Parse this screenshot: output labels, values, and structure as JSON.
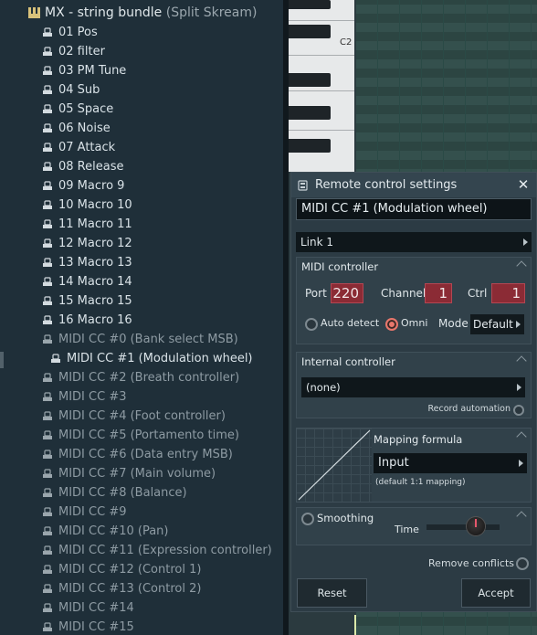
{
  "browser": {
    "header": {
      "title": "MX - string bundle",
      "subtitle": "(Split Skream)"
    },
    "items": [
      {
        "label": "01 Pos",
        "style": "bright"
      },
      {
        "label": "02 filter",
        "style": "bright"
      },
      {
        "label": "03 PM Tune",
        "style": "bright"
      },
      {
        "label": "04 Sub",
        "style": "bright"
      },
      {
        "label": "05 Space",
        "style": "bright"
      },
      {
        "label": "06 Noise",
        "style": "bright"
      },
      {
        "label": "07 Attack",
        "style": "bright"
      },
      {
        "label": "08 Release",
        "style": "bright"
      },
      {
        "label": "09 Macro 9",
        "style": "bright"
      },
      {
        "label": "10 Macro 10",
        "style": "bright"
      },
      {
        "label": "11 Macro 11",
        "style": "bright"
      },
      {
        "label": "12 Macro 12",
        "style": "bright"
      },
      {
        "label": "13 Macro 13",
        "style": "bright"
      },
      {
        "label": "14 Macro 14",
        "style": "bright"
      },
      {
        "label": "15 Macro 15",
        "style": "bright"
      },
      {
        "label": "16 Macro 16",
        "style": "bright"
      },
      {
        "label": "MIDI CC #0 (Bank select MSB)",
        "style": "dim"
      },
      {
        "label": "MIDI CC #1 (Modulation wheel)",
        "style": "selected"
      },
      {
        "label": "MIDI CC #2 (Breath controller)",
        "style": "dim"
      },
      {
        "label": "MIDI CC #3",
        "style": "dim"
      },
      {
        "label": "MIDI CC #4 (Foot controller)",
        "style": "dim"
      },
      {
        "label": "MIDI CC #5 (Portamento time)",
        "style": "dim"
      },
      {
        "label": "MIDI CC #6 (Data entry MSB)",
        "style": "dim"
      },
      {
        "label": "MIDI CC #7 (Main volume)",
        "style": "dim"
      },
      {
        "label": "MIDI CC #8 (Balance)",
        "style": "dim"
      },
      {
        "label": "MIDI CC #9",
        "style": "dim"
      },
      {
        "label": "MIDI CC #10 (Pan)",
        "style": "dim"
      },
      {
        "label": "MIDI CC #11 (Expression controller)",
        "style": "dim"
      },
      {
        "label": "MIDI CC #12 (Control 1)",
        "style": "dim"
      },
      {
        "label": "MIDI CC #13 (Control 2)",
        "style": "dim"
      },
      {
        "label": "MIDI CC #14",
        "style": "dim"
      },
      {
        "label": "MIDI CC #15",
        "style": "dim"
      }
    ]
  },
  "piano": {
    "note_label": "C2"
  },
  "dialog": {
    "title": "Remote control settings",
    "close_icon": "close-icon",
    "name": "MIDI CC #1 (Modulation wheel)",
    "link": "Link 1",
    "midi": {
      "title": "MIDI controller",
      "port_label": "Port",
      "port_value": "220",
      "channel_label": "Channel",
      "channel_value": "1",
      "ctrl_label": "Ctrl",
      "ctrl_value": "1",
      "auto_detect_label": "Auto detect",
      "auto_detect_on": false,
      "omni_label": "Omni",
      "omni_on": true,
      "mode_label": "Mode",
      "mode_value": "Default"
    },
    "internal": {
      "title": "Internal controller",
      "value": "(none)",
      "record_label": "Record automation"
    },
    "mapping": {
      "title": "Mapping formula",
      "value": "Input",
      "note": "(default 1:1 mapping)"
    },
    "smoothing": {
      "label": "Smoothing",
      "time_label": "Time"
    },
    "remove_conflicts_label": "Remove conflicts",
    "reset_label": "Reset",
    "accept_label": "Accept"
  },
  "colors": {
    "accent_red": "#8b2b35",
    "omni_on": "#e9776c",
    "panel": "#2c3b44"
  }
}
